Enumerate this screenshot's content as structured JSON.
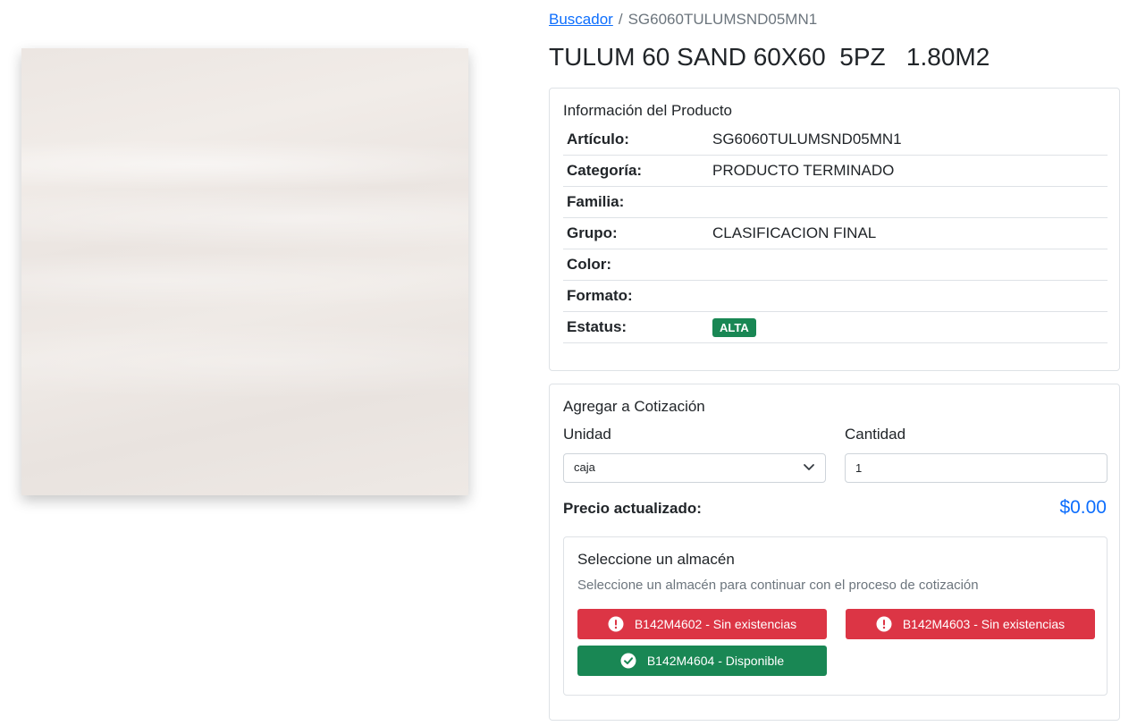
{
  "breadcrumb": {
    "link": "Buscador",
    "separator": "/",
    "current": "SG6060TULUMSND05MN1"
  },
  "product": {
    "title": "TULUM 60 SAND 60X60  5PZ   1.80M2",
    "image_icon": "tile-image"
  },
  "info": {
    "title": "Información del Producto",
    "rows": [
      {
        "label": "Artículo:",
        "value": "SG6060TULUMSND05MN1"
      },
      {
        "label": "Categoría:",
        "value": "PRODUCTO TERMINADO"
      },
      {
        "label": "Familia:",
        "value": ""
      },
      {
        "label": "Grupo:",
        "value": "CLASIFICACION FINAL"
      },
      {
        "label": "Color:",
        "value": ""
      },
      {
        "label": "Formato:",
        "value": ""
      },
      {
        "label": "Estatus:",
        "badge": "ALTA"
      }
    ]
  },
  "quote": {
    "title": "Agregar a Cotización",
    "unit_label": "Unidad",
    "unit_value": "caja",
    "qty_label": "Cantidad",
    "qty_value": "1",
    "price_label": "Precio actualizado:",
    "price_value": "$0.00",
    "warehouse": {
      "title": "Seleccione un almacén",
      "subtitle": "Seleccione un almacén para continuar con el proceso de cotización",
      "options": [
        {
          "label": "B142M4602 - Sin existencias",
          "status": "danger",
          "icon": "exclamation-circle-icon"
        },
        {
          "label": "B142M4603 - Sin existencias",
          "status": "danger",
          "icon": "exclamation-circle-icon"
        },
        {
          "label": "B142M4604 - Disponible",
          "status": "success",
          "icon": "check-circle-icon"
        }
      ]
    }
  },
  "colors": {
    "primary": "#0d6efd",
    "success": "#198754",
    "danger": "#dc3545",
    "muted": "#6c757d"
  }
}
